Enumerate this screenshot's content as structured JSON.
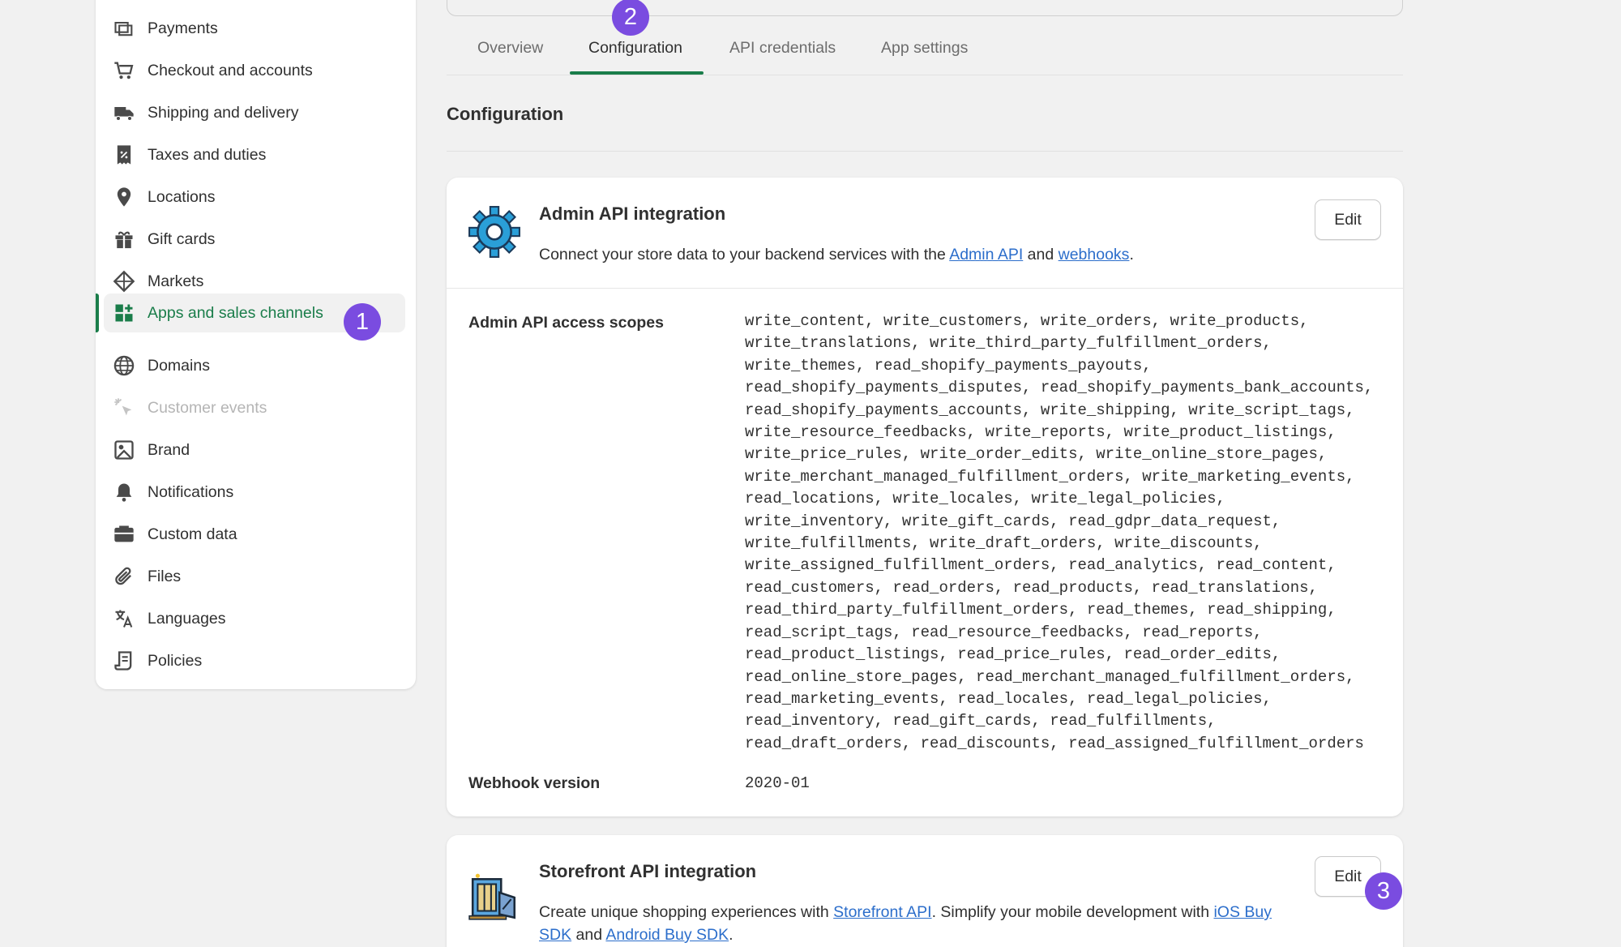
{
  "sidebar": {
    "items": [
      {
        "label": "Payments",
        "icon": "payments-icon"
      },
      {
        "label": "Checkout and accounts",
        "icon": "cart-icon"
      },
      {
        "label": "Shipping and delivery",
        "icon": "truck-icon"
      },
      {
        "label": "Taxes and duties",
        "icon": "receipt-percent-icon"
      },
      {
        "label": "Locations",
        "icon": "location-pin-icon"
      },
      {
        "label": "Gift cards",
        "icon": "gift-icon"
      },
      {
        "label": "Markets",
        "icon": "globe-markets-icon"
      },
      {
        "label": "Apps and sales channels",
        "icon": "apps-icon",
        "active": true
      },
      {
        "label": "Domains",
        "icon": "globe-icon"
      },
      {
        "label": "Customer events",
        "icon": "cursor-sparkle-icon",
        "disabled": true
      },
      {
        "label": "Brand",
        "icon": "brand-icon"
      },
      {
        "label": "Notifications",
        "icon": "bell-icon"
      },
      {
        "label": "Custom data",
        "icon": "database-icon"
      },
      {
        "label": "Files",
        "icon": "paperclip-icon"
      },
      {
        "label": "Languages",
        "icon": "translate-icon"
      },
      {
        "label": "Policies",
        "icon": "policy-scroll-icon"
      }
    ]
  },
  "badges": {
    "one": "1",
    "two": "2",
    "three": "3"
  },
  "tabs": [
    "Overview",
    "Configuration",
    "API credentials",
    "App settings"
  ],
  "active_tab": "Configuration",
  "section_title": "Configuration",
  "admin_card": {
    "title": "Admin API integration",
    "desc_prefix": "Connect your store data to your backend services with the ",
    "link1": "Admin API",
    "desc_mid": " and ",
    "link2": "webhooks",
    "desc_suffix": ".",
    "edit_label": "Edit",
    "scopes_label": "Admin API access scopes",
    "scopes_lines": [
      "write_content, write_customers, write_orders, write_products,",
      "write_translations, write_third_party_fulfillment_orders,",
      "write_themes, read_shopify_payments_payouts,",
      "read_shopify_payments_disputes, read_shopify_payments_bank_accounts,",
      "read_shopify_payments_accounts, write_shipping, write_script_tags,",
      "write_resource_feedbacks, write_reports, write_product_listings,",
      "write_price_rules, write_order_edits, write_online_store_pages,",
      "write_merchant_managed_fulfillment_orders, write_marketing_events,",
      "read_locations, write_locales, write_legal_policies,",
      "write_inventory, write_gift_cards, read_gdpr_data_request,",
      "write_fulfillments, write_draft_orders, write_discounts,",
      "write_assigned_fulfillment_orders, read_analytics, read_content,",
      "read_customers, read_orders, read_products, read_translations,",
      "read_third_party_fulfillment_orders, read_themes, read_shipping,",
      "read_script_tags, read_resource_feedbacks, read_reports,",
      "read_product_listings, read_price_rules, read_order_edits,",
      "read_online_store_pages, read_merchant_managed_fulfillment_orders,",
      "read_marketing_events, read_locales, read_legal_policies,",
      "read_inventory, read_gift_cards, read_fulfillments,",
      "read_draft_orders, read_discounts, read_assigned_fulfillment_orders"
    ],
    "webhook_label": "Webhook version",
    "webhook_value": "2020-01"
  },
  "storefront_card": {
    "title": "Storefront API integration",
    "desc_prefix": "Create unique shopping experiences with ",
    "link1": "Storefront API",
    "desc_mid": ". Simplify your mobile development with ",
    "link2": "iOS Buy SDK",
    "desc_mid2": " and ",
    "link3": "Android Buy SDK",
    "desc_suffix": ".",
    "edit_label": "Edit"
  },
  "colors": {
    "accent_green": "#1a7d4a",
    "badge_purple": "#7a4ce0",
    "link_blue": "#2c6ecb"
  }
}
